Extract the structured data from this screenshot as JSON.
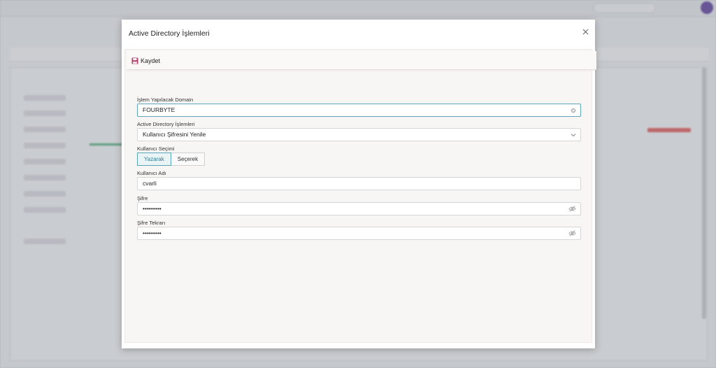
{
  "modal": {
    "title": "Active Directory İşlemleri",
    "close_icon": "close-icon",
    "toolbar": {
      "save_label": "Kaydet",
      "save_icon": "floppy-disk-icon"
    },
    "fields": {
      "domain": {
        "label": "İşlem Yapılacak Domain",
        "value": "FOURBYTE"
      },
      "operation": {
        "label": "Active Directory İşlemleri",
        "value": "Kullanıcı Şifresini Yenile"
      },
      "user_selection": {
        "label": "Kullanıcı Seçimi",
        "options": [
          "Yazarak",
          "Seçerek"
        ],
        "selected": "Yazarak"
      },
      "username": {
        "label": "Kullanıcı Adı",
        "value": "cvarli"
      },
      "password": {
        "label": "Şifre",
        "value": "•••••••••"
      },
      "password_repeat": {
        "label": "Şifre Tekrarı",
        "value": "•••••••••"
      }
    }
  },
  "colors": {
    "accent": "#5aa4b6",
    "save_icon": "#b03a6a",
    "avatar": "#5e3f9e"
  }
}
